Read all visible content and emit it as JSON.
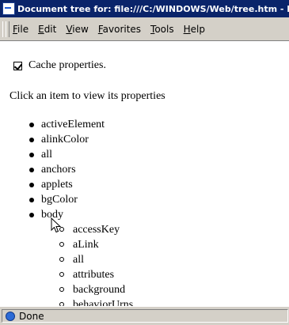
{
  "window": {
    "title": "Document tree for: file:///C:/WINDOWS/Web/tree.htm - Info",
    "icon": "ie-page-icon"
  },
  "menu": {
    "items": [
      "File",
      "Edit",
      "View",
      "Favorites",
      "Tools",
      "Help"
    ]
  },
  "content": {
    "cache_checkbox": {
      "label": "Cache properties.",
      "checked": true
    },
    "prompt": "Click an item to view its properties",
    "items": [
      "activeElement",
      "alinkColor",
      "all",
      "anchors",
      "applets",
      "bgColor",
      "body"
    ],
    "body_children": [
      "accessKey",
      "aLink",
      "all",
      "attributes",
      "background",
      "behaviorUrns"
    ]
  },
  "status": {
    "text": "Done",
    "icon": "ie-globe-icon"
  }
}
